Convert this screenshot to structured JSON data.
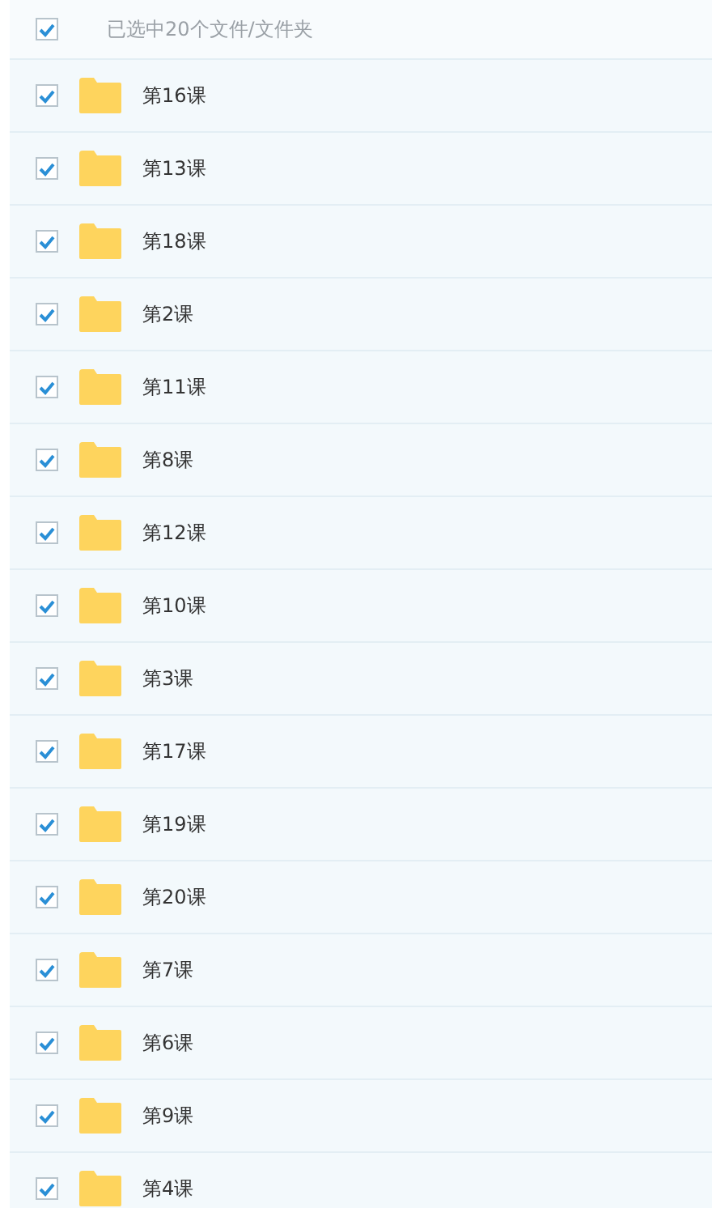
{
  "header": {
    "label": "已选中20个文件/文件夹",
    "checked": true
  },
  "files": [
    {
      "name": "第16课",
      "checked": true
    },
    {
      "name": "第13课",
      "checked": true
    },
    {
      "name": "第18课",
      "checked": true
    },
    {
      "name": "第2课",
      "checked": true
    },
    {
      "name": "第11课",
      "checked": true
    },
    {
      "name": "第8课",
      "checked": true
    },
    {
      "name": "第12课",
      "checked": true
    },
    {
      "name": "第10课",
      "checked": true
    },
    {
      "name": "第3课",
      "checked": true
    },
    {
      "name": "第17课",
      "checked": true
    },
    {
      "name": "第19课",
      "checked": true
    },
    {
      "name": "第20课",
      "checked": true
    },
    {
      "name": "第7课",
      "checked": true
    },
    {
      "name": "第6课",
      "checked": true
    },
    {
      "name": "第9课",
      "checked": true
    },
    {
      "name": "第4课",
      "checked": true
    }
  ]
}
